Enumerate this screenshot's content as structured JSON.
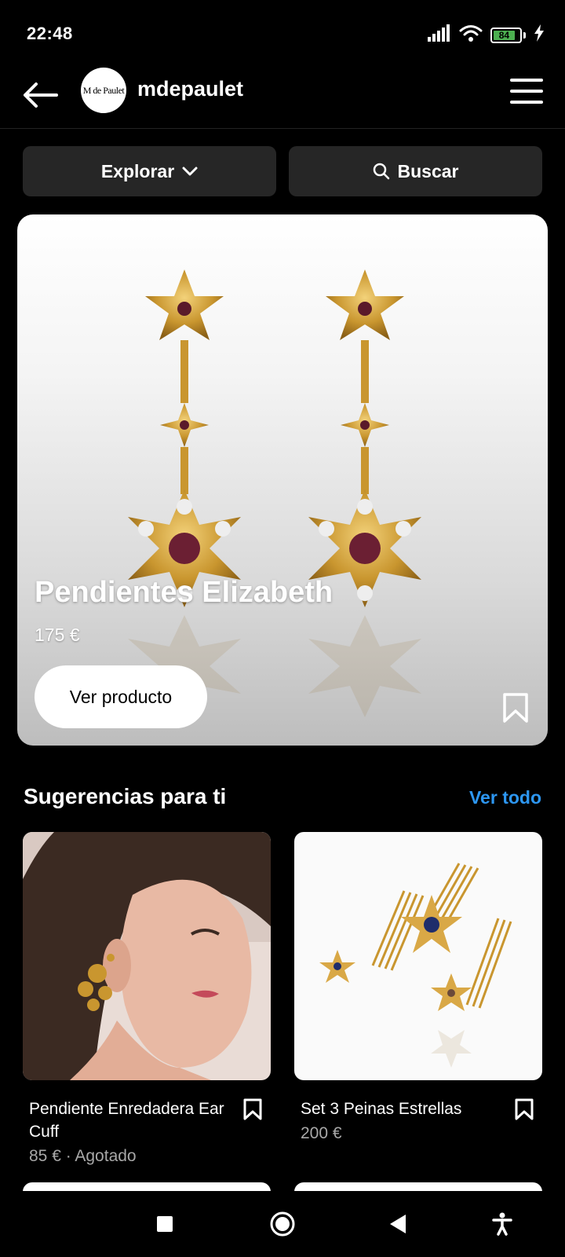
{
  "status": {
    "time": "22:48",
    "battery": "84"
  },
  "header": {
    "shop_name": "mdepaulet",
    "avatar_text": "M de Paulet"
  },
  "actions": {
    "explore_label": "Explorar",
    "search_label": "Buscar"
  },
  "hero": {
    "title": "Pendientes Elizabeth",
    "price": "175 €",
    "cta_label": "Ver producto"
  },
  "suggestions": {
    "title": "Sugerencias para ti",
    "see_all": "Ver todo",
    "items": [
      {
        "name": "Pendiente Enredadera Ear Cuff",
        "meta": "85 € · Agotado"
      },
      {
        "name": "Set 3 Peinas Estrellas",
        "meta": "200 €"
      }
    ]
  },
  "colors": {
    "accent": "#2d97f2",
    "battery": "#4caf50",
    "button_bg": "#262626"
  }
}
